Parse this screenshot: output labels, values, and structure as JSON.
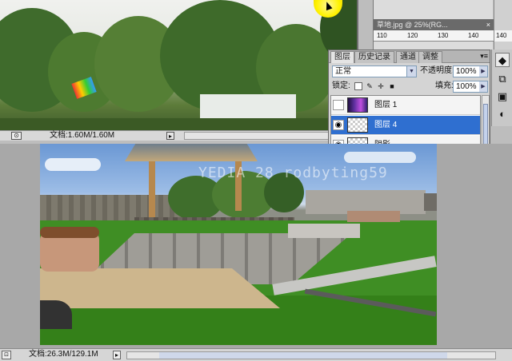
{
  "top_document": {
    "status_text": "文档:1.60M/1.60M"
  },
  "second_document": {
    "title": "草地.jpg @ 25%(RG...",
    "close_symbol": "×",
    "ruler_ticks": [
      "110",
      "120",
      "130",
      "140"
    ],
    "side_ruler_tick": "140"
  },
  "layers_panel": {
    "tabs": [
      {
        "label": "图层",
        "active": true
      },
      {
        "label": "历史记录",
        "active": false
      },
      {
        "label": "通道",
        "active": false
      },
      {
        "label": "调整",
        "active": false
      }
    ],
    "menu_symbol": "▾≡",
    "blend_mode": "正常",
    "opacity_label": "不透明度:",
    "opacity_value": "100%",
    "lock_label": "锁定:",
    "fill_label": "填充:",
    "fill_value": "100%",
    "layers": [
      {
        "name": "图层 1",
        "visible": false,
        "selected": false
      },
      {
        "name": "图层 4",
        "visible": true,
        "selected": true
      },
      {
        "name": "阴影",
        "visible": true,
        "selected": false
      }
    ]
  },
  "main_document": {
    "watermark": "YEDIA 28 rodbyting59",
    "status_text": "文档:26.3M/129.1M"
  },
  "icons": {
    "eye": "eye-icon",
    "lock": "lock-icon",
    "link": "link-icon",
    "fx": "fx-icon",
    "mask": "mask-icon",
    "adjust": "adjustment-icon",
    "folder": "folder-icon",
    "new": "new-layer-icon",
    "trash": "trash-icon"
  },
  "colors": {
    "selection": "#2f6fd0",
    "panel_bg": "#d4d4d4",
    "cursor_highlight": "#fff200"
  }
}
